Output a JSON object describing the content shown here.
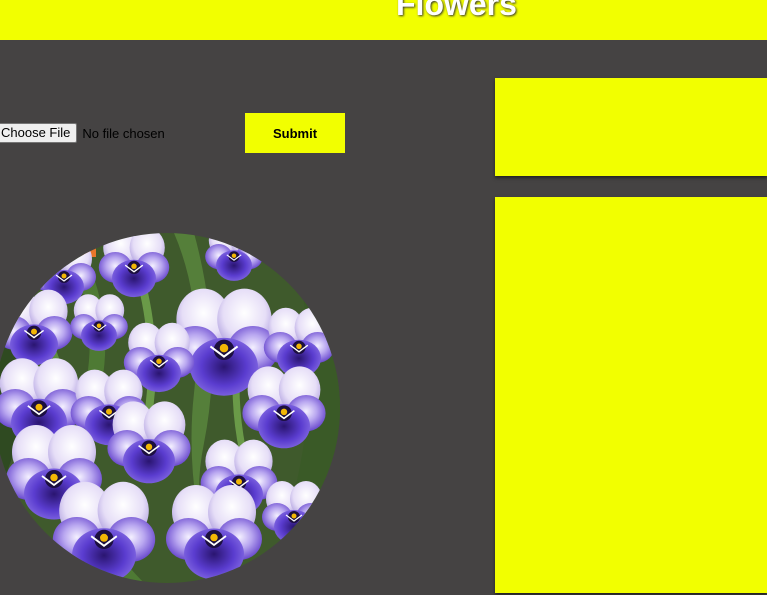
{
  "header": {
    "title": "Flowers"
  },
  "upload": {
    "choose_file_label": "Choose File",
    "file_status": "No file chosen",
    "submit_label": "Submit"
  },
  "colors": {
    "accent": "#f2ff00",
    "background": "#454343",
    "title_text": "#ffffff"
  },
  "image": {
    "subject": "purple pansy flowers"
  }
}
